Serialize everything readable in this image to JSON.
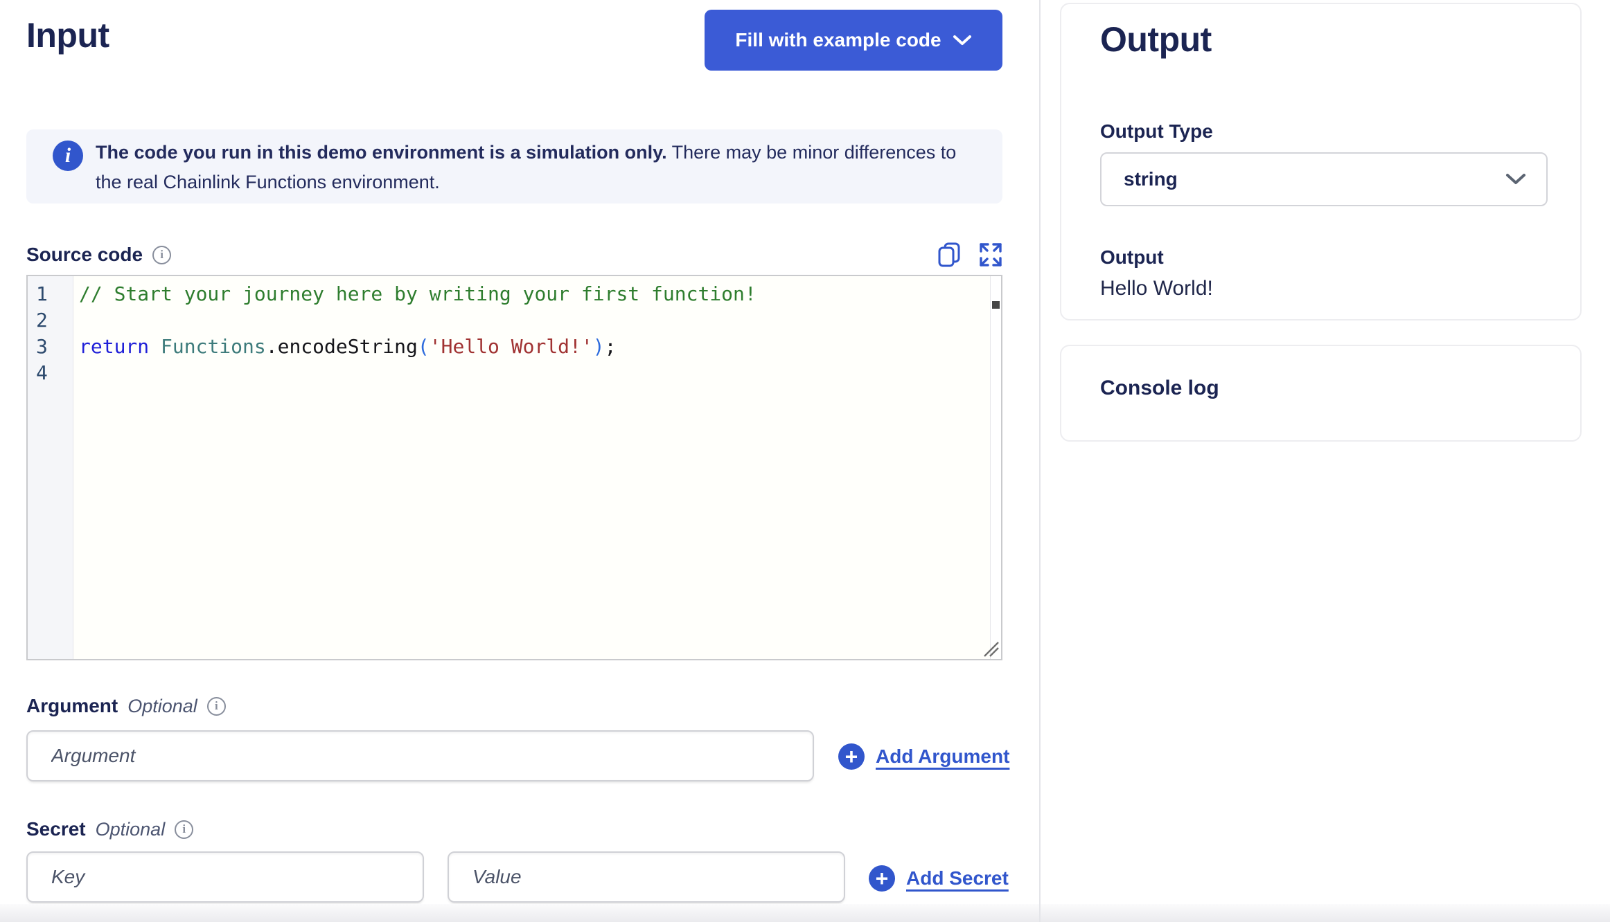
{
  "colors": {
    "brand_blue": "#3b5bd6",
    "link_blue": "#3156cc",
    "heading_navy": "#1b2452",
    "banner_bg": "#f3f5fb",
    "editor_bg": "#fffffb",
    "gutter_bg": "#f5f6f9",
    "code_comment": "#2e7d2e",
    "code_keyword": "#2020d8",
    "code_variable": "#3d7b7b",
    "code_string": "#a03232",
    "code_paren": "#2d6bdd"
  },
  "input_panel": {
    "title": "Input",
    "fill_button_label": "Fill with example code",
    "banner": {
      "bold_text": "The code you run in this demo environment is a simulation only.",
      "rest_text": " There may be minor differences to the real Chainlink Functions environment."
    },
    "source_code": {
      "label": "Source code",
      "lines": [
        {
          "n": "1",
          "tokens": [
            {
              "t": "// Start your journey here by writing your first function!",
              "c": "comment"
            }
          ]
        },
        {
          "n": "2",
          "tokens": []
        },
        {
          "n": "3",
          "tokens": [
            {
              "t": "return",
              "c": "keyword"
            },
            {
              "t": " ",
              "c": "plain"
            },
            {
              "t": "Functions",
              "c": "variable"
            },
            {
              "t": ".",
              "c": "plain"
            },
            {
              "t": "encodeString",
              "c": "plain"
            },
            {
              "t": "(",
              "c": "paren"
            },
            {
              "t": "'Hello World!'",
              "c": "string"
            },
            {
              "t": ")",
              "c": "paren"
            },
            {
              "t": ";",
              "c": "plain"
            }
          ]
        },
        {
          "n": "4",
          "tokens": []
        }
      ]
    },
    "argument": {
      "label": "Argument",
      "optional": "Optional",
      "placeholder": "Argument",
      "value": "",
      "add_label": "Add Argument"
    },
    "secret": {
      "label": "Secret",
      "optional": "Optional",
      "key_placeholder": "Key",
      "key_value": "",
      "value_placeholder": "Value",
      "value_value": "",
      "add_label": "Add Secret"
    }
  },
  "output_panel": {
    "title": "Output",
    "output_type_label": "Output Type",
    "output_type_value": "string",
    "output_label": "Output",
    "output_value": "Hello World!",
    "console_label": "Console log"
  },
  "icons": {
    "banner_info": "i",
    "plus": "+"
  }
}
